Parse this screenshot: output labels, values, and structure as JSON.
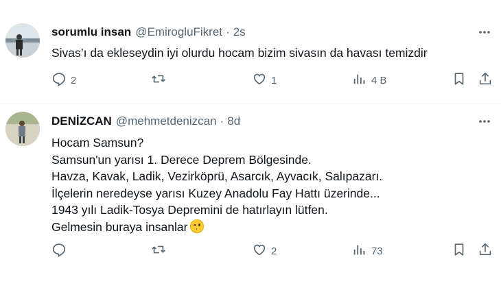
{
  "tweets": [
    {
      "name": "sorumlu insan",
      "handle": "@EmirogluFikret",
      "separator": "·",
      "time": "2s",
      "lines": [
        "Sivas’ı da ekleseydin iyi olurdu hocam bizim sivasın da havası temizdir"
      ],
      "emoji_line": "",
      "actions": {
        "replies": "2",
        "retweets": "",
        "likes": "1",
        "views": "4 B"
      }
    },
    {
      "name": "DENİZCAN",
      "handle": "@mehmetdenizcan",
      "separator": "·",
      "time": "8d",
      "lines": [
        "Hocam Samsun?",
        "Samsun'un yarısı 1. Derece Deprem Bölgesinde.",
        "Havza, Kavak, Ladik, Vezirköprü, Asarcık, Ayvacık, Salıpazarı.",
        "İlçelerin neredeyse yarısı Kuzey Anadolu Fay Hattı üzerinde...",
        "1943 yılı Ladik-Tosya Depremini de hatırlayın lütfen."
      ],
      "emoji_line": "Gelmesin buraya insanlar",
      "actions": {
        "replies": "",
        "retweets": "",
        "likes": "2",
        "views": "73"
      }
    }
  ],
  "icons": {
    "reply": "reply-icon",
    "retweet": "retweet-icon",
    "like": "heart-icon",
    "views": "views-icon",
    "bookmark": "bookmark-icon",
    "share": "share-icon",
    "more": "more-icon",
    "emoji": "winking-face-emoji"
  },
  "colors": {
    "text": "#0f1419",
    "secondary": "#536471",
    "divider": "#eff3f4"
  }
}
